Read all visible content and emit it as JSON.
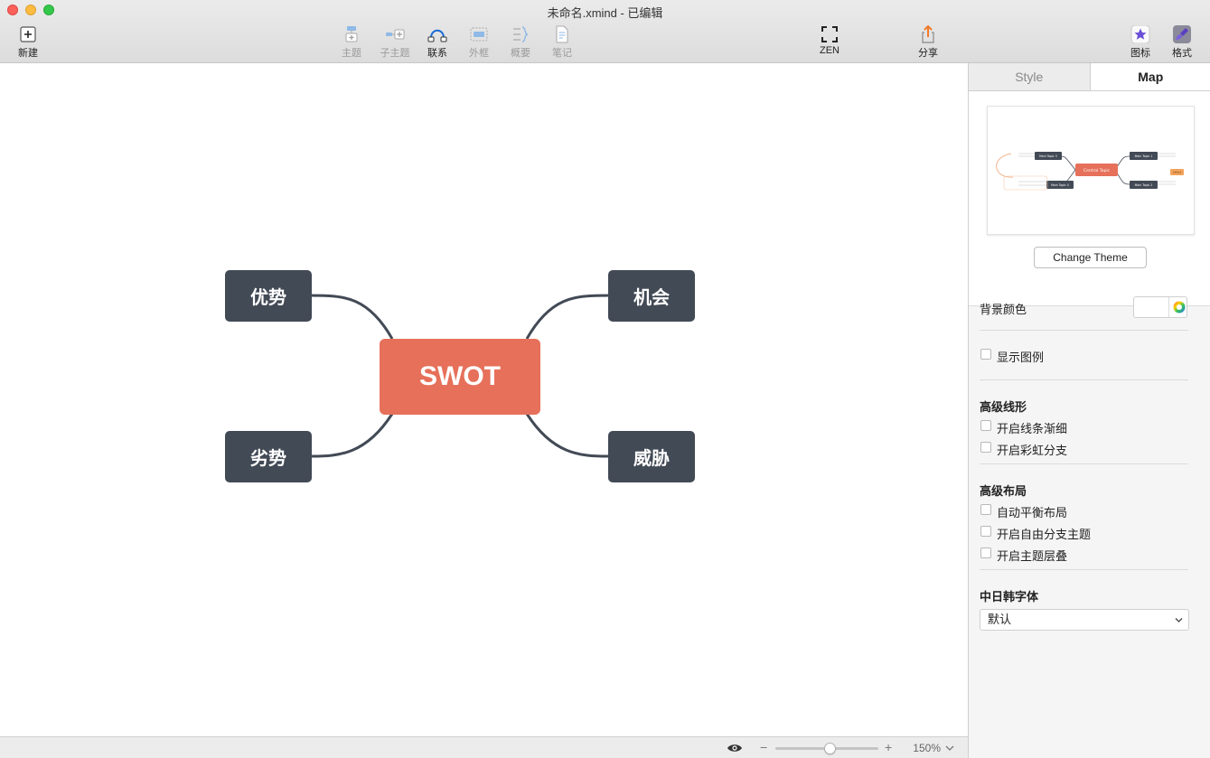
{
  "window": {
    "title": "未命名.xmind - 已编辑"
  },
  "toolbar": {
    "new_label": "新建",
    "topic_label": "主题",
    "subtopic_label": "子主题",
    "relationship_label": "联系",
    "boundary_label": "外框",
    "summary_label": "概要",
    "notes_label": "笔记",
    "zen_label": "ZEN",
    "share_label": "分享",
    "icons_label": "图标",
    "format_label": "格式"
  },
  "mindmap": {
    "central": "SWOT",
    "topics": {
      "strengths": "优势",
      "opportunities": "机会",
      "weaknesses": "劣势",
      "threats": "威胁"
    }
  },
  "statusbar": {
    "zoom": "150%",
    "zoom_level": 0.53
  },
  "panel": {
    "tabs": {
      "style": "Style",
      "map": "Map"
    },
    "thumbnail": {
      "central": "Central Topic",
      "topic1": "Main Topic 1",
      "topic2": "Main Topic 2",
      "topic3": "Main Topic 3",
      "topic4": "Main Topic 4",
      "callout": "Callout"
    },
    "change_theme": "Change Theme",
    "bg_color_label": "背景颜色",
    "show_legend": "显示图例",
    "adv_line_heading": "高级线形",
    "taper_line": "开启线条渐细",
    "rainbow_branch": "开启彩虹分支",
    "adv_layout_heading": "高级布局",
    "auto_balance": "自动平衡布局",
    "free_branch": "开启自由分支主题",
    "topic_overlap": "开启主题层叠",
    "cjk_font_heading": "中日韩字体",
    "cjk_font_value": "默认"
  },
  "colors": {
    "central": "#e6705a",
    "topic": "#424a56",
    "connector": "#424a56"
  }
}
